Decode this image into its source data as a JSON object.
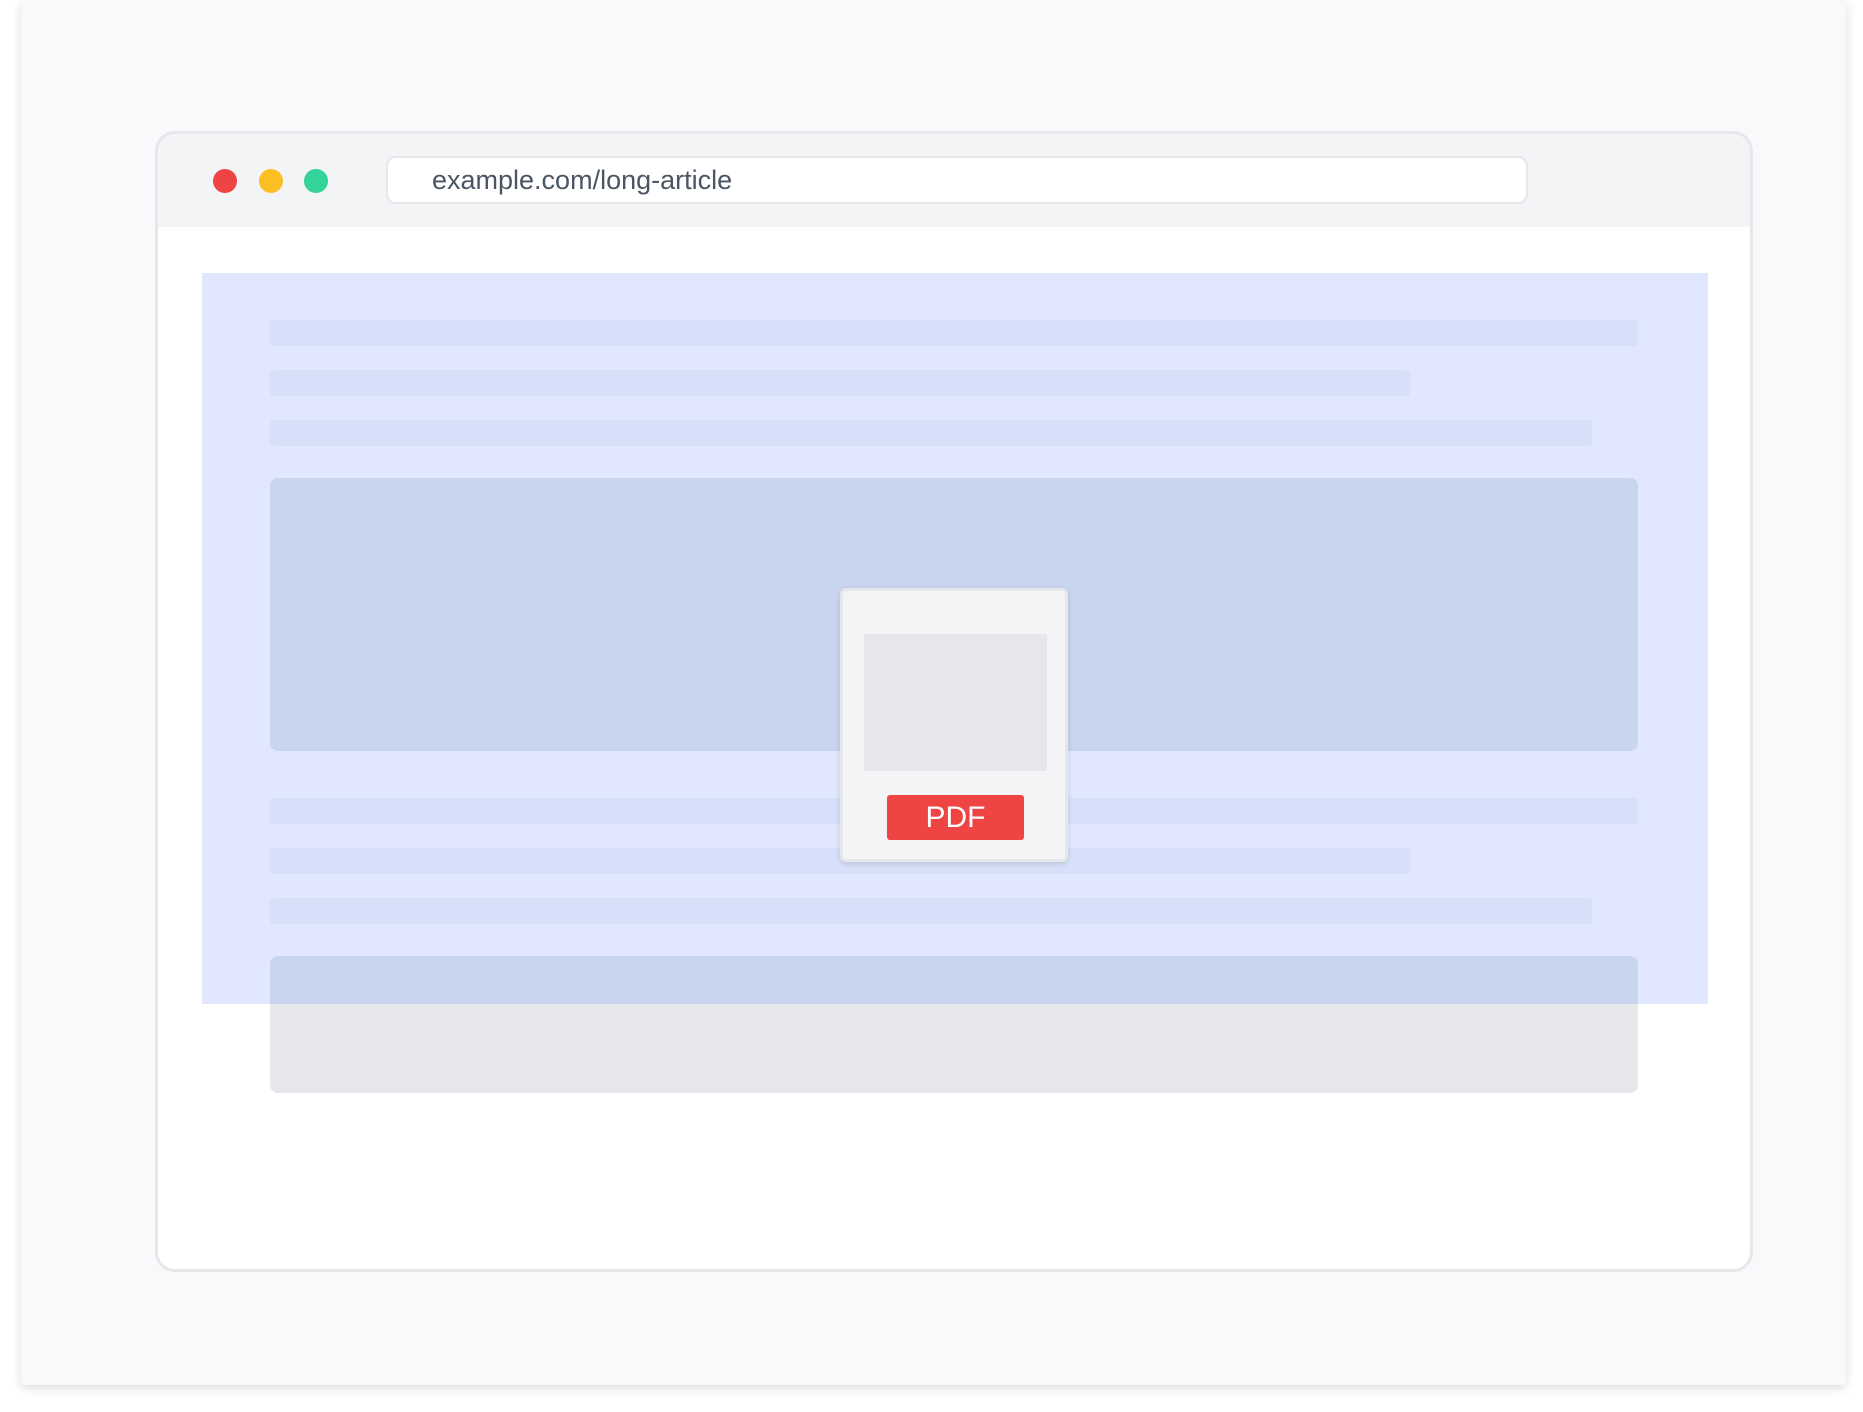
{
  "browser": {
    "window_controls": {
      "close_color": "#ef4444",
      "minimize_color": "#fbbf24",
      "maximize_color": "#34d399"
    },
    "address_bar": {
      "url": "example.com/long-article"
    }
  },
  "pdf_export": {
    "badge_label": "PDF",
    "badge_color": "#ef4444"
  },
  "colors": {
    "selection_highlight": "#e0e7ff",
    "placeholder_line": "#d6e0f8",
    "placeholder_block": "#c9d5ee",
    "background": "#f8f9fa"
  }
}
